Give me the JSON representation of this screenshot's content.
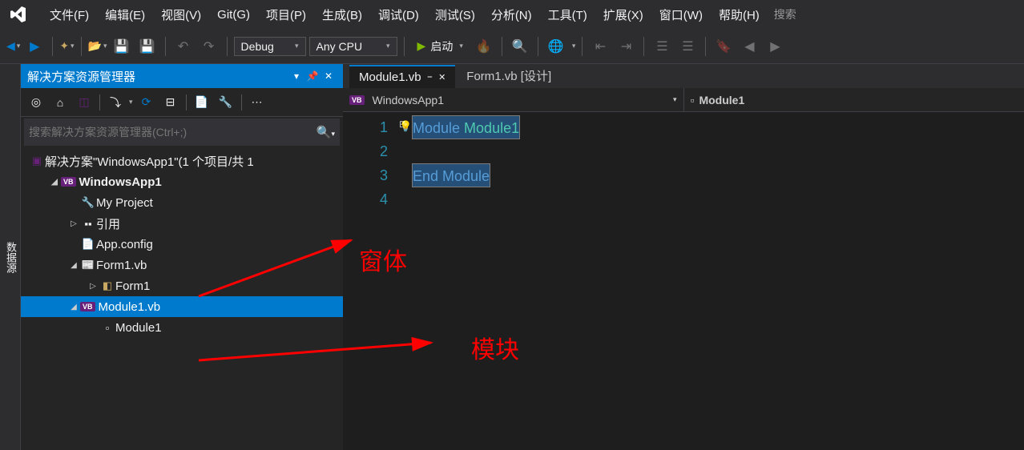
{
  "menu": {
    "file": "文件(F)",
    "edit": "编辑(E)",
    "view": "视图(V)",
    "git": "Git(G)",
    "project": "项目(P)",
    "build": "生成(B)",
    "debug": "调试(D)",
    "test": "测试(S)",
    "analyze": "分析(N)",
    "tools": "工具(T)",
    "extensions": "扩展(X)",
    "window": "窗口(W)",
    "help": "帮助(H)",
    "search": "搜索"
  },
  "toolbar": {
    "config": "Debug",
    "platform": "Any CPU",
    "start": "启动"
  },
  "sidebar_tab": "数据源",
  "panel": {
    "title": "解决方案资源管理器",
    "search_placeholder": "搜索解决方案资源管理器(Ctrl+;)"
  },
  "tree": {
    "solution": "解决方案\"WindowsApp1\"(1 个项目/共 1",
    "project": "WindowsApp1",
    "my_project": "My Project",
    "references": "引用",
    "app_config": "App.config",
    "form1_vb": "Form1.vb",
    "form1": "Form1",
    "module1_vb": "Module1.vb",
    "module1": "Module1"
  },
  "tabs": {
    "module1": "Module1.vb",
    "form1": "Form1.vb [设计]"
  },
  "nav": {
    "left": "WindowsApp1",
    "right": "Module1"
  },
  "code": {
    "lines": [
      "1",
      "2",
      "3",
      "4"
    ],
    "l1_kw": "Module",
    "l1_id": " Module1",
    "l3": "End Module"
  },
  "annotations": {
    "form": "窗体",
    "module": "模块"
  }
}
